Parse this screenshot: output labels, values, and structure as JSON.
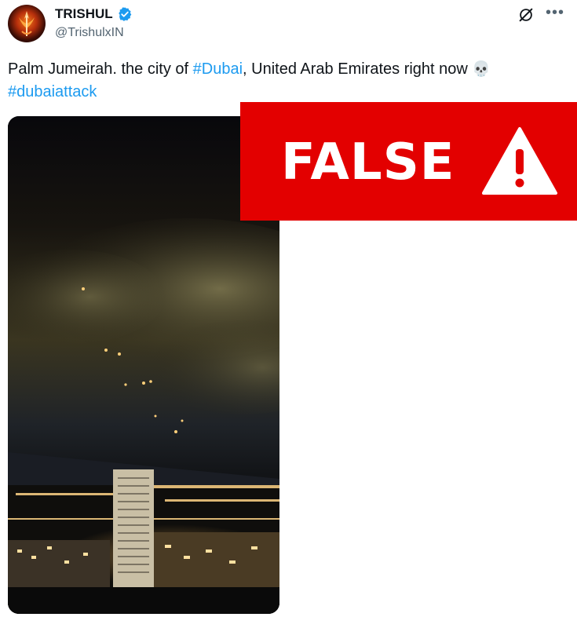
{
  "post": {
    "display_name": "TRISHUL",
    "handle": "@TrishulxIN",
    "text_before": "Palm Jumeirah. the city of ",
    "hashtag_1": "#Dubai",
    "text_after": ", United Arab Emirates right now ",
    "emoji": "💀",
    "hashtag_2": "#dubaiattack"
  },
  "icons": {
    "verified": "verified-badge-icon",
    "grok": "grok-icon",
    "more": "more-icon",
    "warning": "warning-icon"
  },
  "overlay": {
    "label": "FALSE"
  },
  "colors": {
    "link": "#1d9bf0",
    "verified": "#1d9bf0",
    "banner": "#e30000"
  }
}
